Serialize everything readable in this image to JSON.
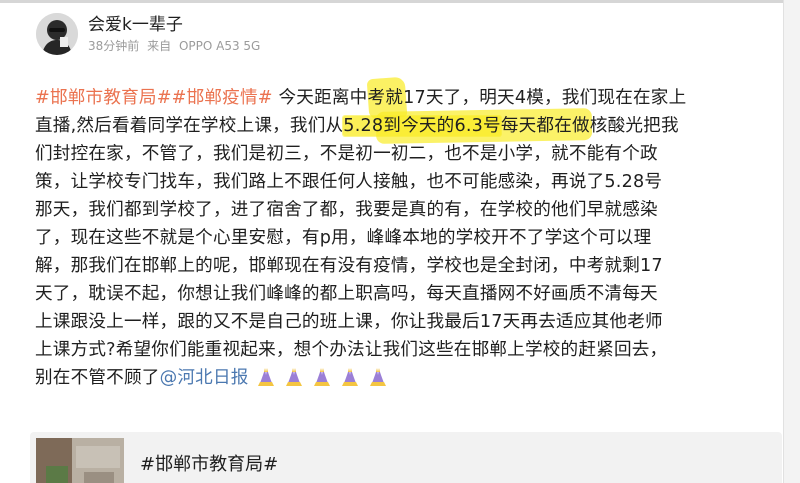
{
  "header": {
    "user_name": "会爱k一辈子",
    "post_time": "38分钟前",
    "source_prefix": "来自",
    "source_device": "OPPO A53 5G"
  },
  "post": {
    "lines": [
      [
        {
          "text": "#邯郸市教育局##邯郸疫情#",
          "type": "topic"
        },
        {
          "text": " 今天距离中考就17天了，明天4模，我们现在在家上",
          "type": "text"
        }
      ],
      [
        {
          "text": "直播,然后看着同学在学校上课，我们从",
          "type": "text"
        },
        {
          "text": "5.28到今天的6.3号",
          "type": "highlight"
        },
        {
          "text": "每天都在做核酸光把我",
          "type": "text"
        }
      ],
      [
        {
          "text": "们封控在家，不管了，我们是初三，不是初一初二，也不是小学，就不能有个政",
          "type": "text"
        }
      ],
      [
        {
          "text": "策，让学校专门找车，我们路上不跟任何人接触，也不可能感染，再说了5.28号",
          "type": "text"
        }
      ],
      [
        {
          "text": "那天，我们都到学校了，进了宿舍了都，我要是真的有，在学校的他们早就感染",
          "type": "text"
        }
      ],
      [
        {
          "text": "了，现在这些不就是个心里安慰，有p用，峰峰本地的学校开不了学这个可以理",
          "type": "text"
        }
      ],
      [
        {
          "text": "解，那我们在邯郸上的呢，邯郸现在有没有疫情，学校也是全封闭，中考就剩17",
          "type": "text"
        }
      ],
      [
        {
          "text": "天了，耽误不起，你想让我们峰峰的都上职高吗，每天直播网不好画质不清每天",
          "type": "text"
        }
      ],
      [
        {
          "text": "上课跟没上一样，跟的又不是自己的班上课，你让我最后17天再去适应其他老师",
          "type": "text"
        }
      ],
      [
        {
          "text": "上课方式?希望你们能重视起来，想个办法让我们这些在邯郸上学校的赶紧回去，",
          "type": "text"
        }
      ],
      [
        {
          "text": "别在不管不顾了",
          "type": "text"
        },
        {
          "text": "@河北日报",
          "type": "mention"
        }
      ]
    ],
    "emoji": [
      "pray-emoji",
      "pray-emoji",
      "pray-emoji",
      "pray-emoji",
      "pray-emoji"
    ]
  },
  "repost": {
    "title": "#邯郸市教育局#"
  },
  "colors": {
    "topic": "#eb7350",
    "mention": "#4b78b0",
    "highlight": "#faec28"
  }
}
